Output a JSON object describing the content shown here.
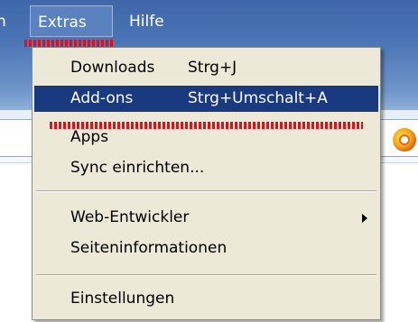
{
  "menubar": {
    "partial_label": "n",
    "extras_label": "Extras",
    "help_label": "Hilfe"
  },
  "menu": {
    "items": [
      {
        "label": "Downloads",
        "shortcut": "Strg+J"
      },
      {
        "label": "Add-ons",
        "shortcut": "Strg+Umschalt+A",
        "selected": true
      },
      {
        "label": "Apps",
        "shortcut": ""
      },
      {
        "label": "Sync einrichten...",
        "shortcut": ""
      },
      {
        "label": "Web-Entwickler",
        "shortcut": "",
        "submenu": true
      },
      {
        "label": "Seiteninformationen",
        "shortcut": ""
      },
      {
        "label": "Einstellungen",
        "shortcut": ""
      }
    ]
  },
  "colors": {
    "menubar": "#4a74b5",
    "menu_background": "#ece9d8",
    "selection": "#1a3a80",
    "marker": "#e0101a"
  },
  "icons": {
    "search_engine": "duckduckgo-icon",
    "submenu": "chevron-right-icon"
  }
}
